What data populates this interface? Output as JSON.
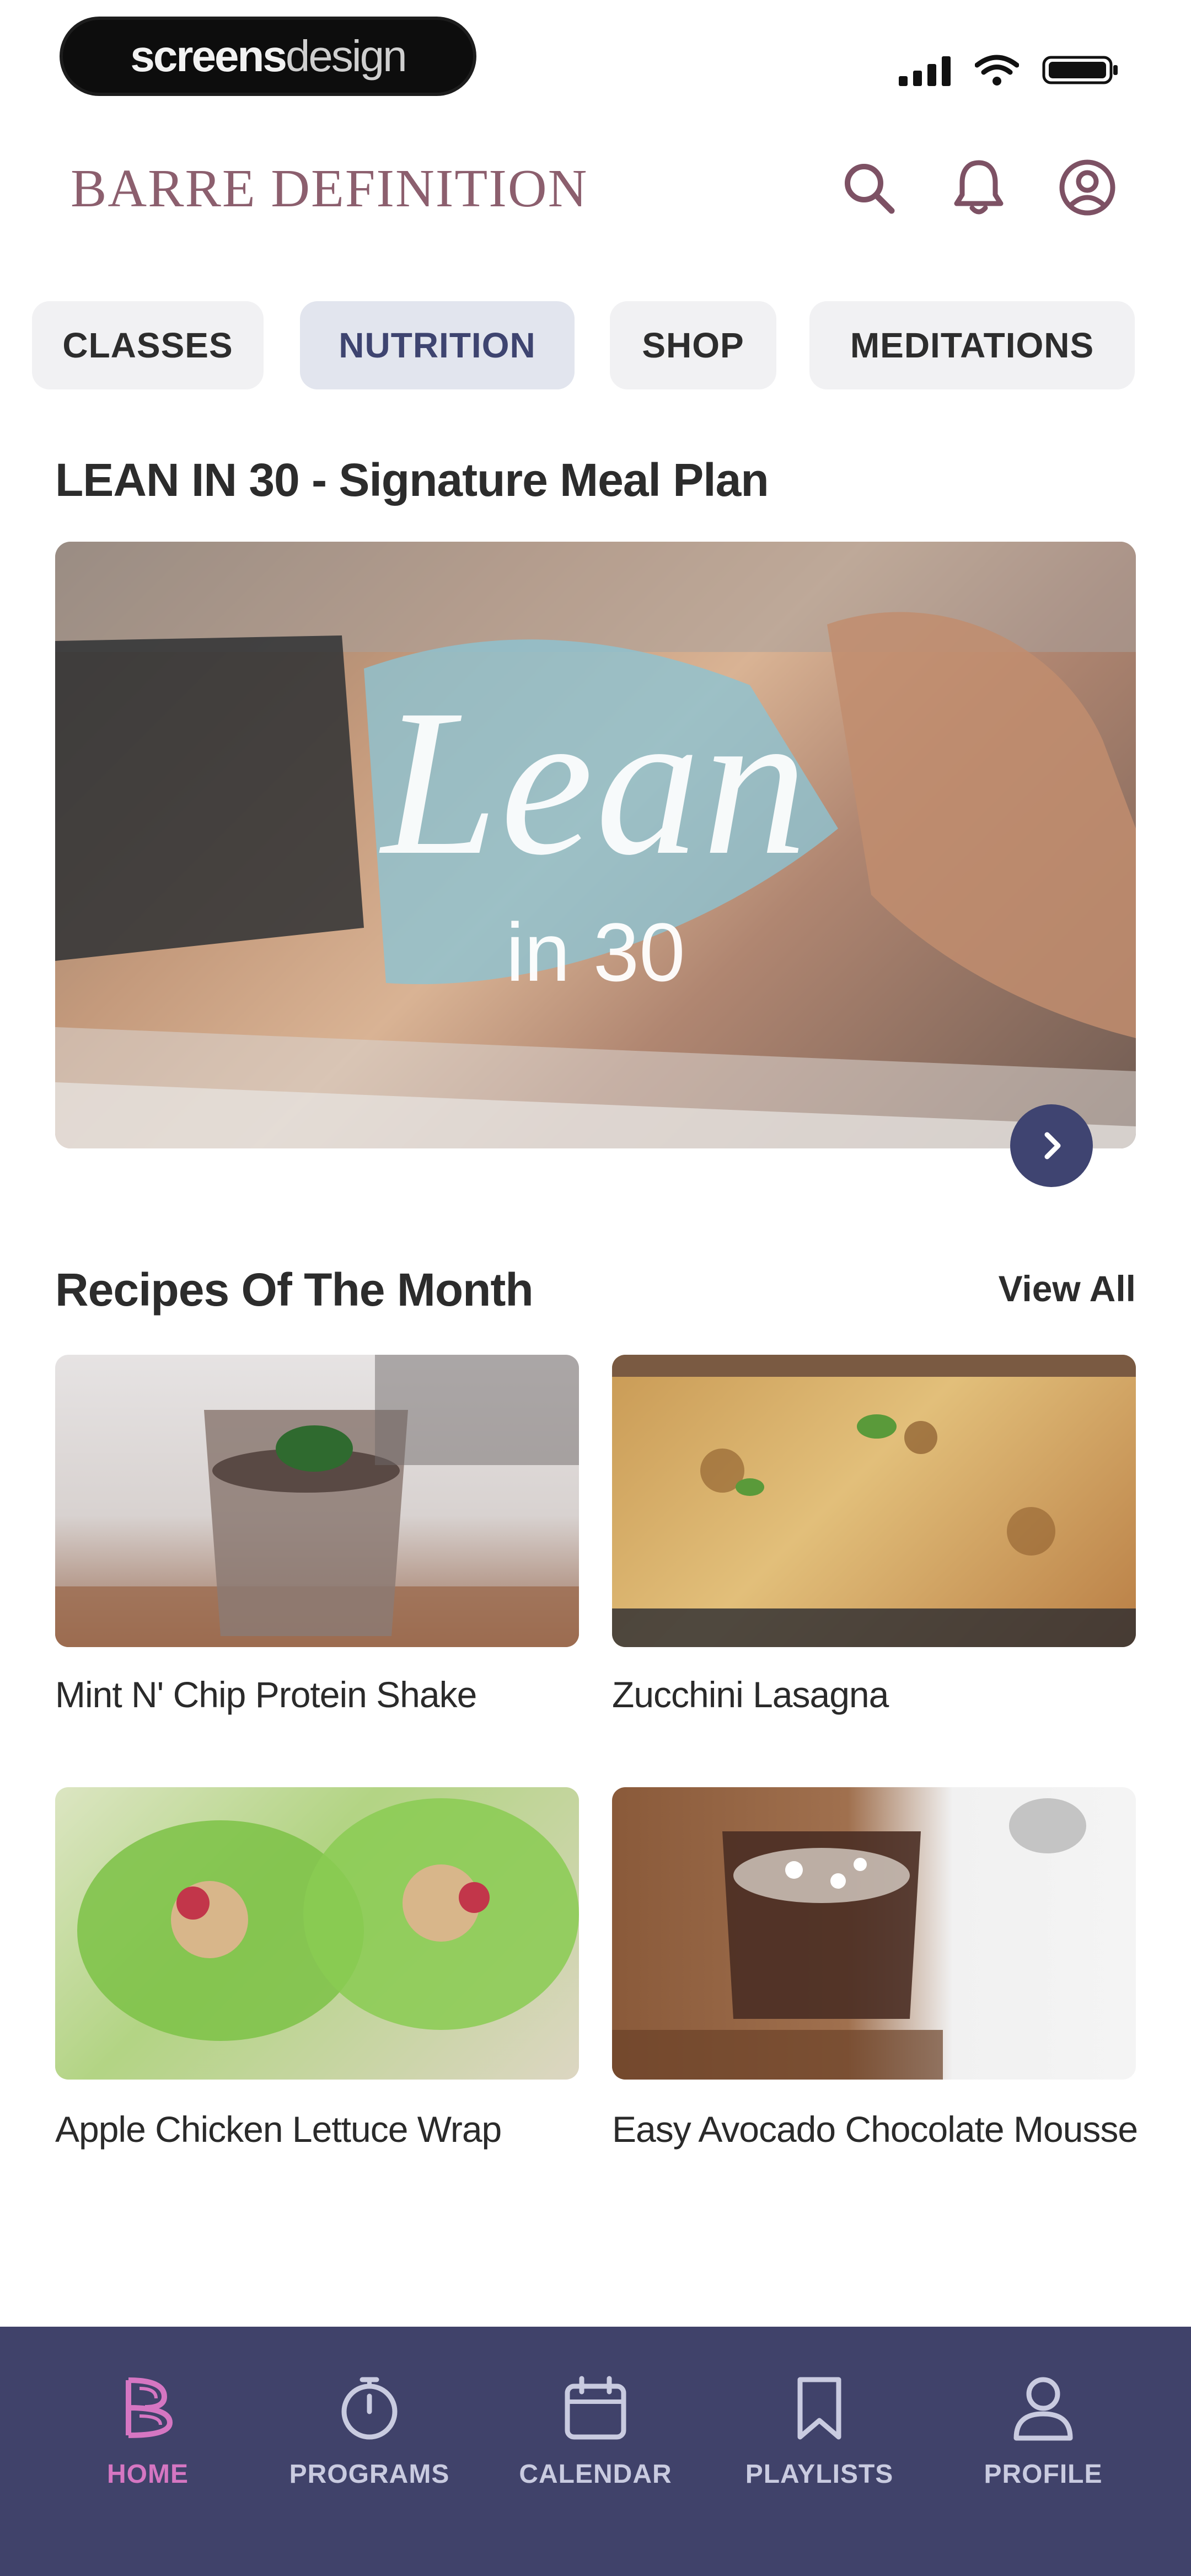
{
  "watermark": {
    "bold": "screens",
    "light": "design"
  },
  "header": {
    "brand": "BARRE DEFINITION"
  },
  "tabs": [
    {
      "label": "CLASSES",
      "active": false
    },
    {
      "label": "NUTRITION",
      "active": true
    },
    {
      "label": "SHOP",
      "active": false
    },
    {
      "label": "MEDITATIONS",
      "active": false
    }
  ],
  "featured": {
    "title": "LEAN IN 30 - Signature Meal Plan",
    "hero_title": "Lean",
    "hero_subtitle": "in 30"
  },
  "recipes": {
    "title": "Recipes Of The Month",
    "view_all": "View All",
    "items": [
      {
        "name": "Mint N' Chip Protein Shake"
      },
      {
        "name": "Zucchini Lasagna"
      },
      {
        "name": "Apple Chicken Lettuce Wrap"
      },
      {
        "name": "Easy Avocado Chocolate Mousse"
      }
    ]
  },
  "bottom_nav": [
    {
      "label": "HOME",
      "active": true
    },
    {
      "label": "PROGRAMS",
      "active": false
    },
    {
      "label": "CALENDAR",
      "active": false
    },
    {
      "label": "PLAYLISTS",
      "active": false
    },
    {
      "label": "PROFILE",
      "active": false
    }
  ],
  "colors": {
    "brand": "#8c5f6e",
    "accent_navy": "#40426a",
    "active_tab_bg": "#e2e5ee",
    "active_nav": "#d576c2"
  }
}
